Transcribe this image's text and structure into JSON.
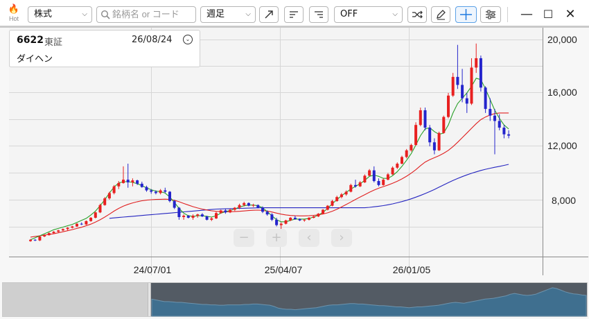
{
  "toolbar": {
    "hot_label": "Hot",
    "market_select": "株式",
    "search_placeholder": "銘柄名 or コード",
    "period_select": "週足",
    "overlay_select": "OFF",
    "icons": [
      "line-up-icon",
      "align-left-icon",
      "align-right-icon",
      "shuffle-icon",
      "pencil-icon",
      "crosshair-icon",
      "settings-icon"
    ]
  },
  "window": {
    "minimize": "—",
    "maximize": "☐",
    "close": "✕"
  },
  "info": {
    "code": "6622",
    "exchange": "東証",
    "date": "26/08/24",
    "name": "ダイヘン"
  },
  "colors": {
    "up": "#e82020",
    "down": "#2424cc",
    "ma_short": "#28a028",
    "ma_mid": "#e02020",
    "ma_long": "#2424c0"
  },
  "chart_data": {
    "type": "candlestick",
    "y_ticks": [
      "20,000",
      "16,000",
      "12,000",
      "8,000"
    ],
    "x_ticks": [
      "24/07/01",
      "25/04/07",
      "26/01/05"
    ],
    "ylim": [
      4000,
      21000
    ],
    "candles": [
      [
        4900,
        5050,
        4850,
        5000
      ],
      [
        5000,
        5050,
        4900,
        4950
      ],
      [
        4950,
        5300,
        4900,
        5250
      ],
      [
        5250,
        5400,
        5200,
        5350
      ],
      [
        5350,
        5550,
        5300,
        5500
      ],
      [
        5500,
        5650,
        5450,
        5600
      ],
      [
        5600,
        5750,
        5550,
        5700
      ],
      [
        5700,
        5850,
        5650,
        5800
      ],
      [
        5800,
        5950,
        5700,
        5900
      ],
      [
        5900,
        6050,
        5850,
        6000
      ],
      [
        6000,
        6250,
        5950,
        6200
      ],
      [
        6200,
        6300,
        6100,
        6150
      ],
      [
        6150,
        6450,
        6100,
        6400
      ],
      [
        6400,
        6700,
        6350,
        6650
      ],
      [
        6650,
        7100,
        6600,
        7050
      ],
      [
        7050,
        7700,
        7000,
        7600
      ],
      [
        7600,
        8200,
        7550,
        8100
      ],
      [
        8100,
        8600,
        8000,
        8500
      ],
      [
        8500,
        9100,
        8400,
        9000
      ],
      [
        9000,
        9400,
        8800,
        9250
      ],
      [
        9250,
        10500,
        9200,
        9500
      ],
      [
        9500,
        10700,
        8900,
        9300
      ],
      [
        9300,
        9600,
        9000,
        9450
      ],
      [
        9450,
        9500,
        9100,
        9200
      ],
      [
        9200,
        9350,
        8900,
        8950
      ],
      [
        8950,
        9050,
        8600,
        8700
      ],
      [
        8700,
        8800,
        8450,
        8600
      ],
      [
        8600,
        8700,
        8400,
        8500
      ],
      [
        8500,
        8800,
        8400,
        8700
      ],
      [
        8700,
        8900,
        8500,
        8600
      ],
      [
        8600,
        8650,
        7800,
        7900
      ],
      [
        7900,
        8000,
        7300,
        7400
      ],
      [
        7400,
        7450,
        6500,
        6700
      ],
      [
        6700,
        6900,
        6500,
        6800
      ],
      [
        6800,
        6850,
        6600,
        6650
      ],
      [
        6650,
        6900,
        6500,
        6800
      ],
      [
        6800,
        6950,
        6650,
        6900
      ],
      [
        6900,
        7000,
        6700,
        6750
      ],
      [
        6750,
        6800,
        6450,
        6500
      ],
      [
        6500,
        6700,
        6400,
        6600
      ],
      [
        6600,
        7100,
        6550,
        7000
      ],
      [
        7000,
        7250,
        6950,
        7200
      ],
      [
        7200,
        7300,
        6950,
        7050
      ],
      [
        7050,
        7300,
        7000,
        7250
      ],
      [
        7250,
        7450,
        7150,
        7400
      ],
      [
        7400,
        7700,
        7300,
        7600
      ],
      [
        7600,
        7850,
        7500,
        7750
      ],
      [
        7750,
        7800,
        7500,
        7550
      ],
      [
        7550,
        7700,
        7450,
        7600
      ],
      [
        7600,
        7650,
        7350,
        7400
      ],
      [
        7400,
        7500,
        7000,
        7100
      ],
      [
        7100,
        7200,
        6800,
        6900
      ],
      [
        6900,
        7000,
        6400,
        6500
      ],
      [
        6500,
        6650,
        6000,
        6100
      ],
      [
        6100,
        6300,
        5800,
        6200
      ],
      [
        6200,
        6500,
        6150,
        6450
      ],
      [
        6450,
        6700,
        6400,
        6650
      ],
      [
        6650,
        6800,
        6500,
        6550
      ],
      [
        6550,
        6600,
        6400,
        6450
      ],
      [
        6450,
        6550,
        6350,
        6500
      ],
      [
        6500,
        6700,
        6450,
        6650
      ],
      [
        6650,
        6800,
        6600,
        6750
      ],
      [
        6750,
        7000,
        6700,
        6950
      ],
      [
        6950,
        7300,
        6900,
        7250
      ],
      [
        7250,
        7600,
        7200,
        7550
      ],
      [
        7550,
        8000,
        7500,
        7900
      ],
      [
        7900,
        8300,
        7850,
        8200
      ],
      [
        8200,
        8500,
        8100,
        8400
      ],
      [
        8400,
        8700,
        8300,
        8600
      ],
      [
        8600,
        9200,
        8550,
        9100
      ],
      [
        9100,
        9500,
        8900,
        9000
      ],
      [
        9000,
        9400,
        8950,
        9300
      ],
      [
        9300,
        9900,
        9250,
        9800
      ],
      [
        9800,
        10300,
        9750,
        10200
      ],
      [
        10200,
        10500,
        9300,
        9400
      ],
      [
        9400,
        9600,
        9000,
        9100
      ],
      [
        9100,
        9600,
        9050,
        9500
      ],
      [
        9500,
        10000,
        9450,
        9900
      ],
      [
        9900,
        10500,
        9850,
        10400
      ],
      [
        10400,
        10800,
        10300,
        10700
      ],
      [
        10700,
        11300,
        10650,
        11200
      ],
      [
        11200,
        11800,
        11100,
        11700
      ],
      [
        11700,
        12200,
        11600,
        12100
      ],
      [
        12100,
        13800,
        12050,
        13600
      ],
      [
        13600,
        14900,
        13500,
        14700
      ],
      [
        14700,
        14900,
        13200,
        13400
      ],
      [
        13400,
        13600,
        12000,
        12300
      ],
      [
        12300,
        12600,
        11400,
        11700
      ],
      [
        11700,
        13100,
        11650,
        13000
      ],
      [
        13000,
        14300,
        12950,
        14200
      ],
      [
        14200,
        16000,
        14100,
        15800
      ],
      [
        15800,
        17500,
        15700,
        17200
      ],
      [
        17200,
        19600,
        16300,
        16600
      ],
      [
        16600,
        17800,
        15300,
        15600
      ],
      [
        15600,
        16000,
        14500,
        15200
      ],
      [
        15200,
        18600,
        15100,
        17900
      ],
      [
        17900,
        19700,
        17500,
        18600
      ],
      [
        18600,
        18800,
        16100,
        16400
      ],
      [
        16400,
        16500,
        14500,
        14800
      ],
      [
        14800,
        15600,
        13900,
        14300
      ],
      [
        14300,
        14800,
        11400,
        13900
      ],
      [
        13900,
        14400,
        13200,
        13400
      ],
      [
        13400,
        13600,
        12600,
        12900
      ],
      [
        12900,
        13200,
        12600,
        12800
      ]
    ],
    "series": [
      {
        "name": "",
        "values": [
          5000,
          5150,
          5300,
          5450,
          5600,
          5750,
          5850,
          5950,
          6050,
          6150,
          6300,
          6450,
          6600,
          6850,
          7150,
          7550,
          8000,
          8500,
          8950,
          9250,
          9350,
          9350,
          9300,
          9200,
          9050,
          8900,
          8750,
          8650,
          8600,
          8500,
          8200,
          7800,
          7350,
          7000,
          6800,
          6750,
          6800,
          6800,
          6750,
          6700,
          6800,
          7000,
          7100,
          7200,
          7300,
          7450,
          7550,
          7600,
          7600,
          7550,
          7400,
          7100,
          6800,
          6500,
          6350,
          6350,
          6450,
          6550,
          6550,
          6550,
          6600,
          6700,
          6850,
          7050,
          7350,
          7700,
          8000,
          8300,
          8550,
          8800,
          9000,
          9200,
          9450,
          9750,
          9850,
          9750,
          9600,
          9600,
          9800,
          10100,
          10500,
          10950,
          11450,
          12100,
          12800,
          13300,
          13400,
          13100,
          12900,
          13000,
          13600,
          14500,
          15200,
          15600,
          16000,
          16500,
          17100,
          17000,
          16300,
          15500,
          14700,
          14100,
          13600,
          13300
        ]
      },
      {
        "name": "",
        "values": [
          5200,
          5250,
          5300,
          5350,
          5400,
          5450,
          5520,
          5600,
          5680,
          5760,
          5850,
          5940,
          6050,
          6170,
          6320,
          6500,
          6700,
          6920,
          7150,
          7350,
          7520,
          7650,
          7760,
          7850,
          7920,
          7970,
          8000,
          8020,
          8030,
          8040,
          8020,
          7960,
          7850,
          7720,
          7600,
          7480,
          7380,
          7300,
          7230,
          7170,
          7130,
          7110,
          7100,
          7100,
          7110,
          7130,
          7160,
          7190,
          7210,
          7220,
          7200,
          7150,
          7080,
          7000,
          6920,
          6860,
          6820,
          6800,
          6790,
          6790,
          6800,
          6830,
          6870,
          6930,
          7020,
          7140,
          7290,
          7460,
          7640,
          7830,
          8020,
          8200,
          8380,
          8560,
          8720,
          8860,
          8980,
          9100,
          9230,
          9380,
          9560,
          9760,
          9990,
          10250,
          10550,
          10820,
          11000,
          11150,
          11300,
          11480,
          11700,
          11980,
          12300,
          12650,
          13000,
          13350,
          13700,
          14000,
          14200,
          14350,
          14450,
          14500,
          14500,
          14500
        ]
      },
      {
        "name": "",
        "values": [
          6100,
          6130,
          6160,
          6190,
          6220,
          6250,
          6280,
          6310,
          6340,
          6370,
          6400,
          6430,
          6460,
          6490,
          6520,
          6550,
          6580,
          6610,
          6640,
          6670,
          6700,
          6730,
          6760,
          6790,
          6820,
          6850,
          6880,
          6910,
          6940,
          6970,
          7000,
          7030,
          7060,
          7090,
          7120,
          7150,
          7180,
          7210,
          7240,
          7270,
          7300,
          7310,
          7320,
          7330,
          7340,
          7350,
          7360,
          7370,
          7380,
          7390,
          7400,
          7400,
          7400,
          7400,
          7400,
          7400,
          7400,
          7400,
          7400,
          7400,
          7400,
          7400,
          7400,
          7400,
          7400,
          7400,
          7400,
          7400,
          7400,
          7400,
          7400,
          7400,
          7400,
          7430,
          7470,
          7510,
          7560,
          7620,
          7690,
          7770,
          7860,
          7960,
          8070,
          8190,
          8320,
          8460,
          8610,
          8770,
          8940,
          9110,
          9280,
          9440,
          9590,
          9730,
          9860,
          9980,
          10090,
          10190,
          10280,
          10360,
          10430,
          10500,
          10570,
          10650
        ]
      }
    ],
    "navigator_values": [
      42,
      40,
      38,
      36,
      36,
      35,
      34,
      34,
      33,
      32,
      31,
      30,
      29,
      29,
      28,
      28,
      27,
      27,
      28,
      28,
      28,
      28,
      29,
      29,
      30,
      30,
      29,
      28,
      27,
      24,
      20,
      18,
      17,
      17,
      16,
      17,
      18,
      19,
      20,
      21,
      23,
      25,
      27,
      28,
      28,
      29,
      30,
      31,
      31,
      30,
      30,
      29,
      28,
      27,
      26,
      26,
      25,
      24,
      23,
      23,
      22,
      21,
      22,
      23,
      23,
      24,
      25,
      26,
      27,
      29,
      31,
      33,
      34,
      33,
      32,
      34,
      36,
      38,
      40,
      42,
      43,
      44,
      46,
      48,
      50,
      54,
      56,
      54,
      52,
      51,
      52,
      54,
      58,
      62,
      66,
      70,
      68,
      64,
      60,
      57,
      55,
      54,
      52,
      51
    ],
    "navigator_ylim": [
      0,
      80
    ]
  },
  "navigator_buttons": [
    "−",
    "+",
    "‹",
    "›"
  ]
}
